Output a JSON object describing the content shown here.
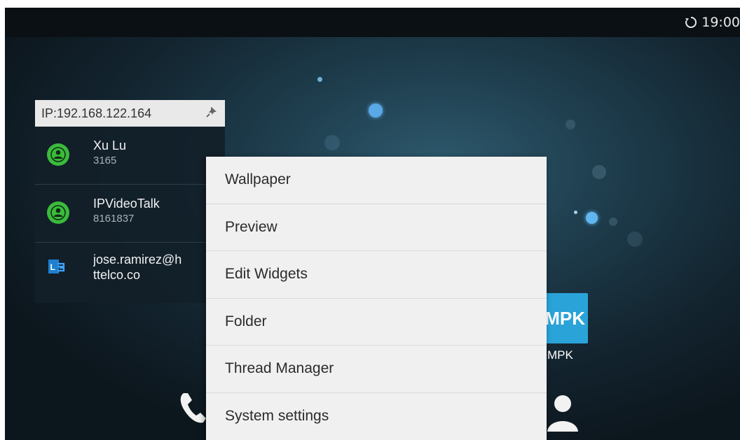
{
  "status_bar": {
    "time": "19:00",
    "sync_icon": "sync-icon"
  },
  "widget": {
    "ip_label": "IP:192.168.122.164",
    "pin_icon": "pin-icon",
    "contacts": [
      {
        "name": "Xu Lu",
        "number": "3165",
        "icon": "contact-avatar-icon"
      },
      {
        "name": "IPVideoTalk",
        "number": "8161837",
        "icon": "contact-avatar-icon"
      },
      {
        "email_line1": "jose.ramirez@h",
        "email_line2": "ttelco.co",
        "icon": "lync-icon"
      }
    ]
  },
  "app": {
    "mpk_tile_text": "MPK",
    "mpk_label": "MPK"
  },
  "menu": {
    "items": [
      {
        "label": "Wallpaper"
      },
      {
        "label": "Preview"
      },
      {
        "label": "Edit Widgets"
      },
      {
        "label": "Folder"
      },
      {
        "label": "Thread Manager"
      },
      {
        "label": "System settings"
      }
    ]
  },
  "colors": {
    "accent": "#2aa3d9",
    "avatar_green": "#3bbb3b",
    "menu_bg": "#f0f0f0"
  }
}
